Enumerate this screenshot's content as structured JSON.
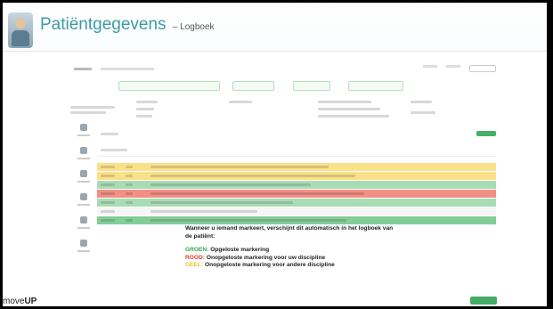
{
  "slide": {
    "title": "Patiëntgegevens",
    "subtitle": "– Logboek",
    "footer_brand_prefix": "move",
    "footer_brand_suffix": "UP"
  },
  "callout": {
    "intro": "Wanneer u iemand markeert, verschijnt dit automatisch in het logboek van de patiënt:",
    "groen_label": "GROEN:",
    "groen_text": "Opgeloste markering",
    "rood_label": "ROOD:",
    "rood_text": "Onopgeloste markering voor uw discipline",
    "geel_label": "GEEL:",
    "geel_text": "Onopgeloste markering voor andere discipline"
  },
  "colors": {
    "title": "#3b9ba6",
    "green": "#3aa255",
    "red": "#e23a2b",
    "yellow": "#f2c12e",
    "row_yellow": "#fbe08a",
    "row_green": "#a8dcb4",
    "row_red": "#f28f86",
    "row_green_dark": "#83cd98"
  }
}
